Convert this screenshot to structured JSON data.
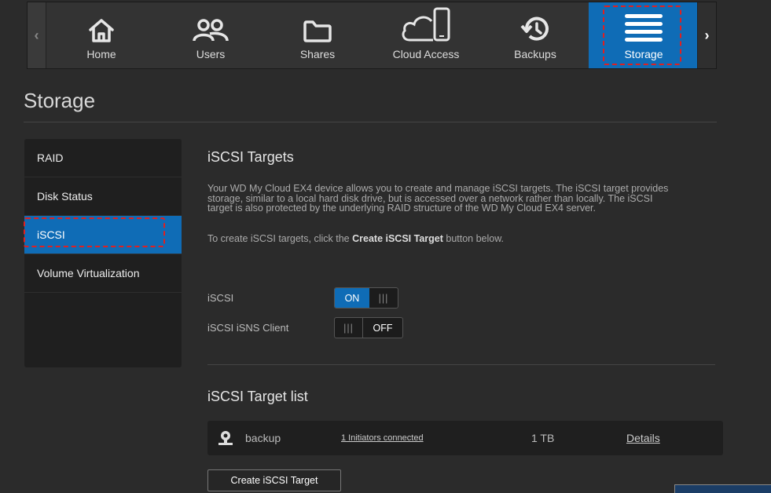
{
  "nav": {
    "items": [
      {
        "label": "Home",
        "icon": "home-icon"
      },
      {
        "label": "Users",
        "icon": "users-icon"
      },
      {
        "label": "Shares",
        "icon": "folder-icon"
      },
      {
        "label": "Cloud Access",
        "icon": "cloud-device-icon"
      },
      {
        "label": "Backups",
        "icon": "history-icon"
      },
      {
        "label": "Storage",
        "icon": "storage-icon",
        "active": true
      }
    ],
    "left_arrow": "‹",
    "right_arrow": "›"
  },
  "page": {
    "title": "Storage"
  },
  "sidebar": {
    "items": [
      {
        "label": "RAID"
      },
      {
        "label": "Disk Status"
      },
      {
        "label": "iSCSI",
        "active": true
      },
      {
        "label": "Volume Virtualization"
      }
    ]
  },
  "main": {
    "heading": "iSCSI Targets",
    "description_lines": [
      "Your WD My Cloud EX4 device allows you to create and manage iSCSI targets. The iSCSI target provides",
      "storage, similar to a local hard disk drive, but is accessed over a network rather than locally. The iSCSI",
      "target is also protected by the underlying RAID structure of the WD My Cloud EX4 server."
    ],
    "instruction_prefix": "To create iSCSI targets, click the ",
    "instruction_bold": "Create iSCSI Target",
    "instruction_suffix": " button below.",
    "iscsi_label": "iSCSI",
    "iscsi_toggle": {
      "on_text": "ON",
      "grip": "|||",
      "state": "on"
    },
    "isns_label": "iSCSI iSNS Client",
    "isns_toggle": {
      "grip": "|||",
      "off_text": "OFF",
      "state": "off"
    },
    "target_list_heading": "iSCSI Target list",
    "targets": [
      {
        "name": "backup",
        "initiators": "1 Initiators connected",
        "size": "1 TB",
        "details": "Details"
      }
    ],
    "create_button": "Create iSCSI Target"
  },
  "colors": {
    "accent": "#0f6cb6",
    "highlight": "#e02020",
    "background": "#2b2b2b"
  }
}
